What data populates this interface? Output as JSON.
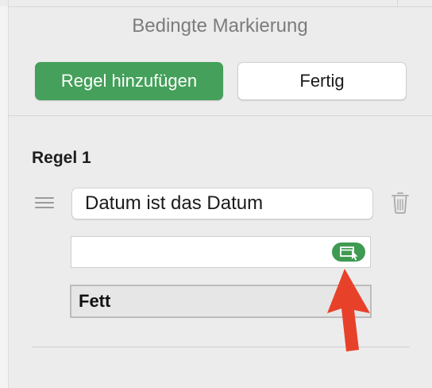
{
  "panel": {
    "title": "Bedingte Markierung"
  },
  "buttons": {
    "add_rule": "Regel hinzufügen",
    "done": "Fertig"
  },
  "rule": {
    "heading": "Regel 1",
    "condition": "Datum ist das Datum",
    "value": "",
    "style_label": "Fett"
  },
  "colors": {
    "accent_green": "#44a05a",
    "annotation_arrow": "#e8412a",
    "panel_background": "#ececec"
  },
  "icons": {
    "drag_handle": "drag-handle-icon",
    "delete": "trash-icon",
    "date_picker": "date-picker-icon",
    "annotation": "red-arrow"
  }
}
